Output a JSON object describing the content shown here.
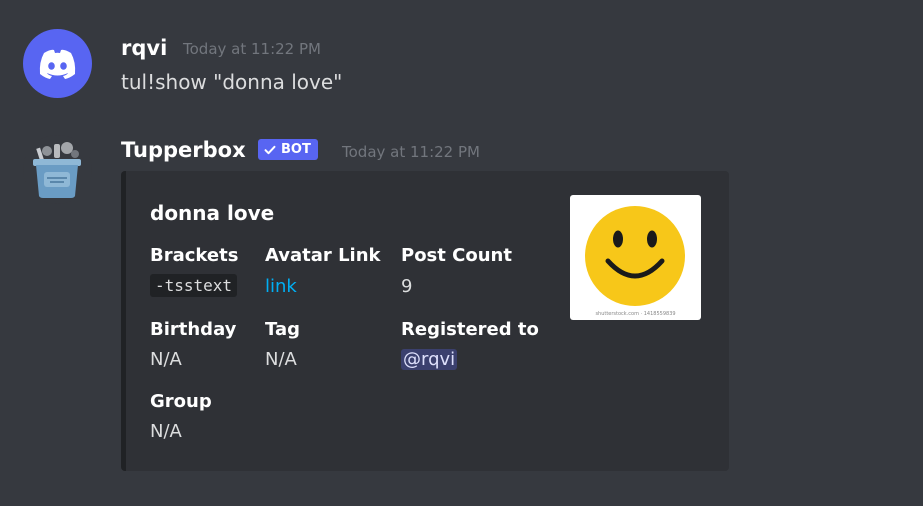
{
  "messages": [
    {
      "author": "rqvi",
      "timestamp": "Today at 11:22 PM",
      "content": "tul!show \"donna love\"",
      "avatar_icon": "discord-logo-icon",
      "avatar_color": "#5865f2"
    },
    {
      "author": "Tupperbox",
      "timestamp": "Today at 11:22 PM",
      "bot_tag": "BOT",
      "avatar_icon": "tupperbox-icon",
      "embed": {
        "title": "donna love",
        "fields": {
          "brackets": {
            "name": "Brackets",
            "value": "-tsstext"
          },
          "avatar_link": {
            "name": "Avatar Link",
            "value": "link"
          },
          "post_count": {
            "name": "Post Count",
            "value": "9"
          },
          "birthday": {
            "name": "Birthday",
            "value": "N/A"
          },
          "tag": {
            "name": "Tag",
            "value": "N/A"
          },
          "registered_to": {
            "name": "Registered to",
            "value": "@rqvi"
          },
          "group": {
            "name": "Group",
            "value": "N/A"
          }
        },
        "thumbnail_icon": "smiley-face-icon",
        "thumbnail_caption": "shutterstock.com · 1418559839"
      }
    }
  ],
  "colors": {
    "background": "#36393f",
    "embed_background": "#2f3136",
    "blurple": "#5865f2",
    "link": "#00aff4",
    "smiley_yellow": "#f7c719"
  }
}
